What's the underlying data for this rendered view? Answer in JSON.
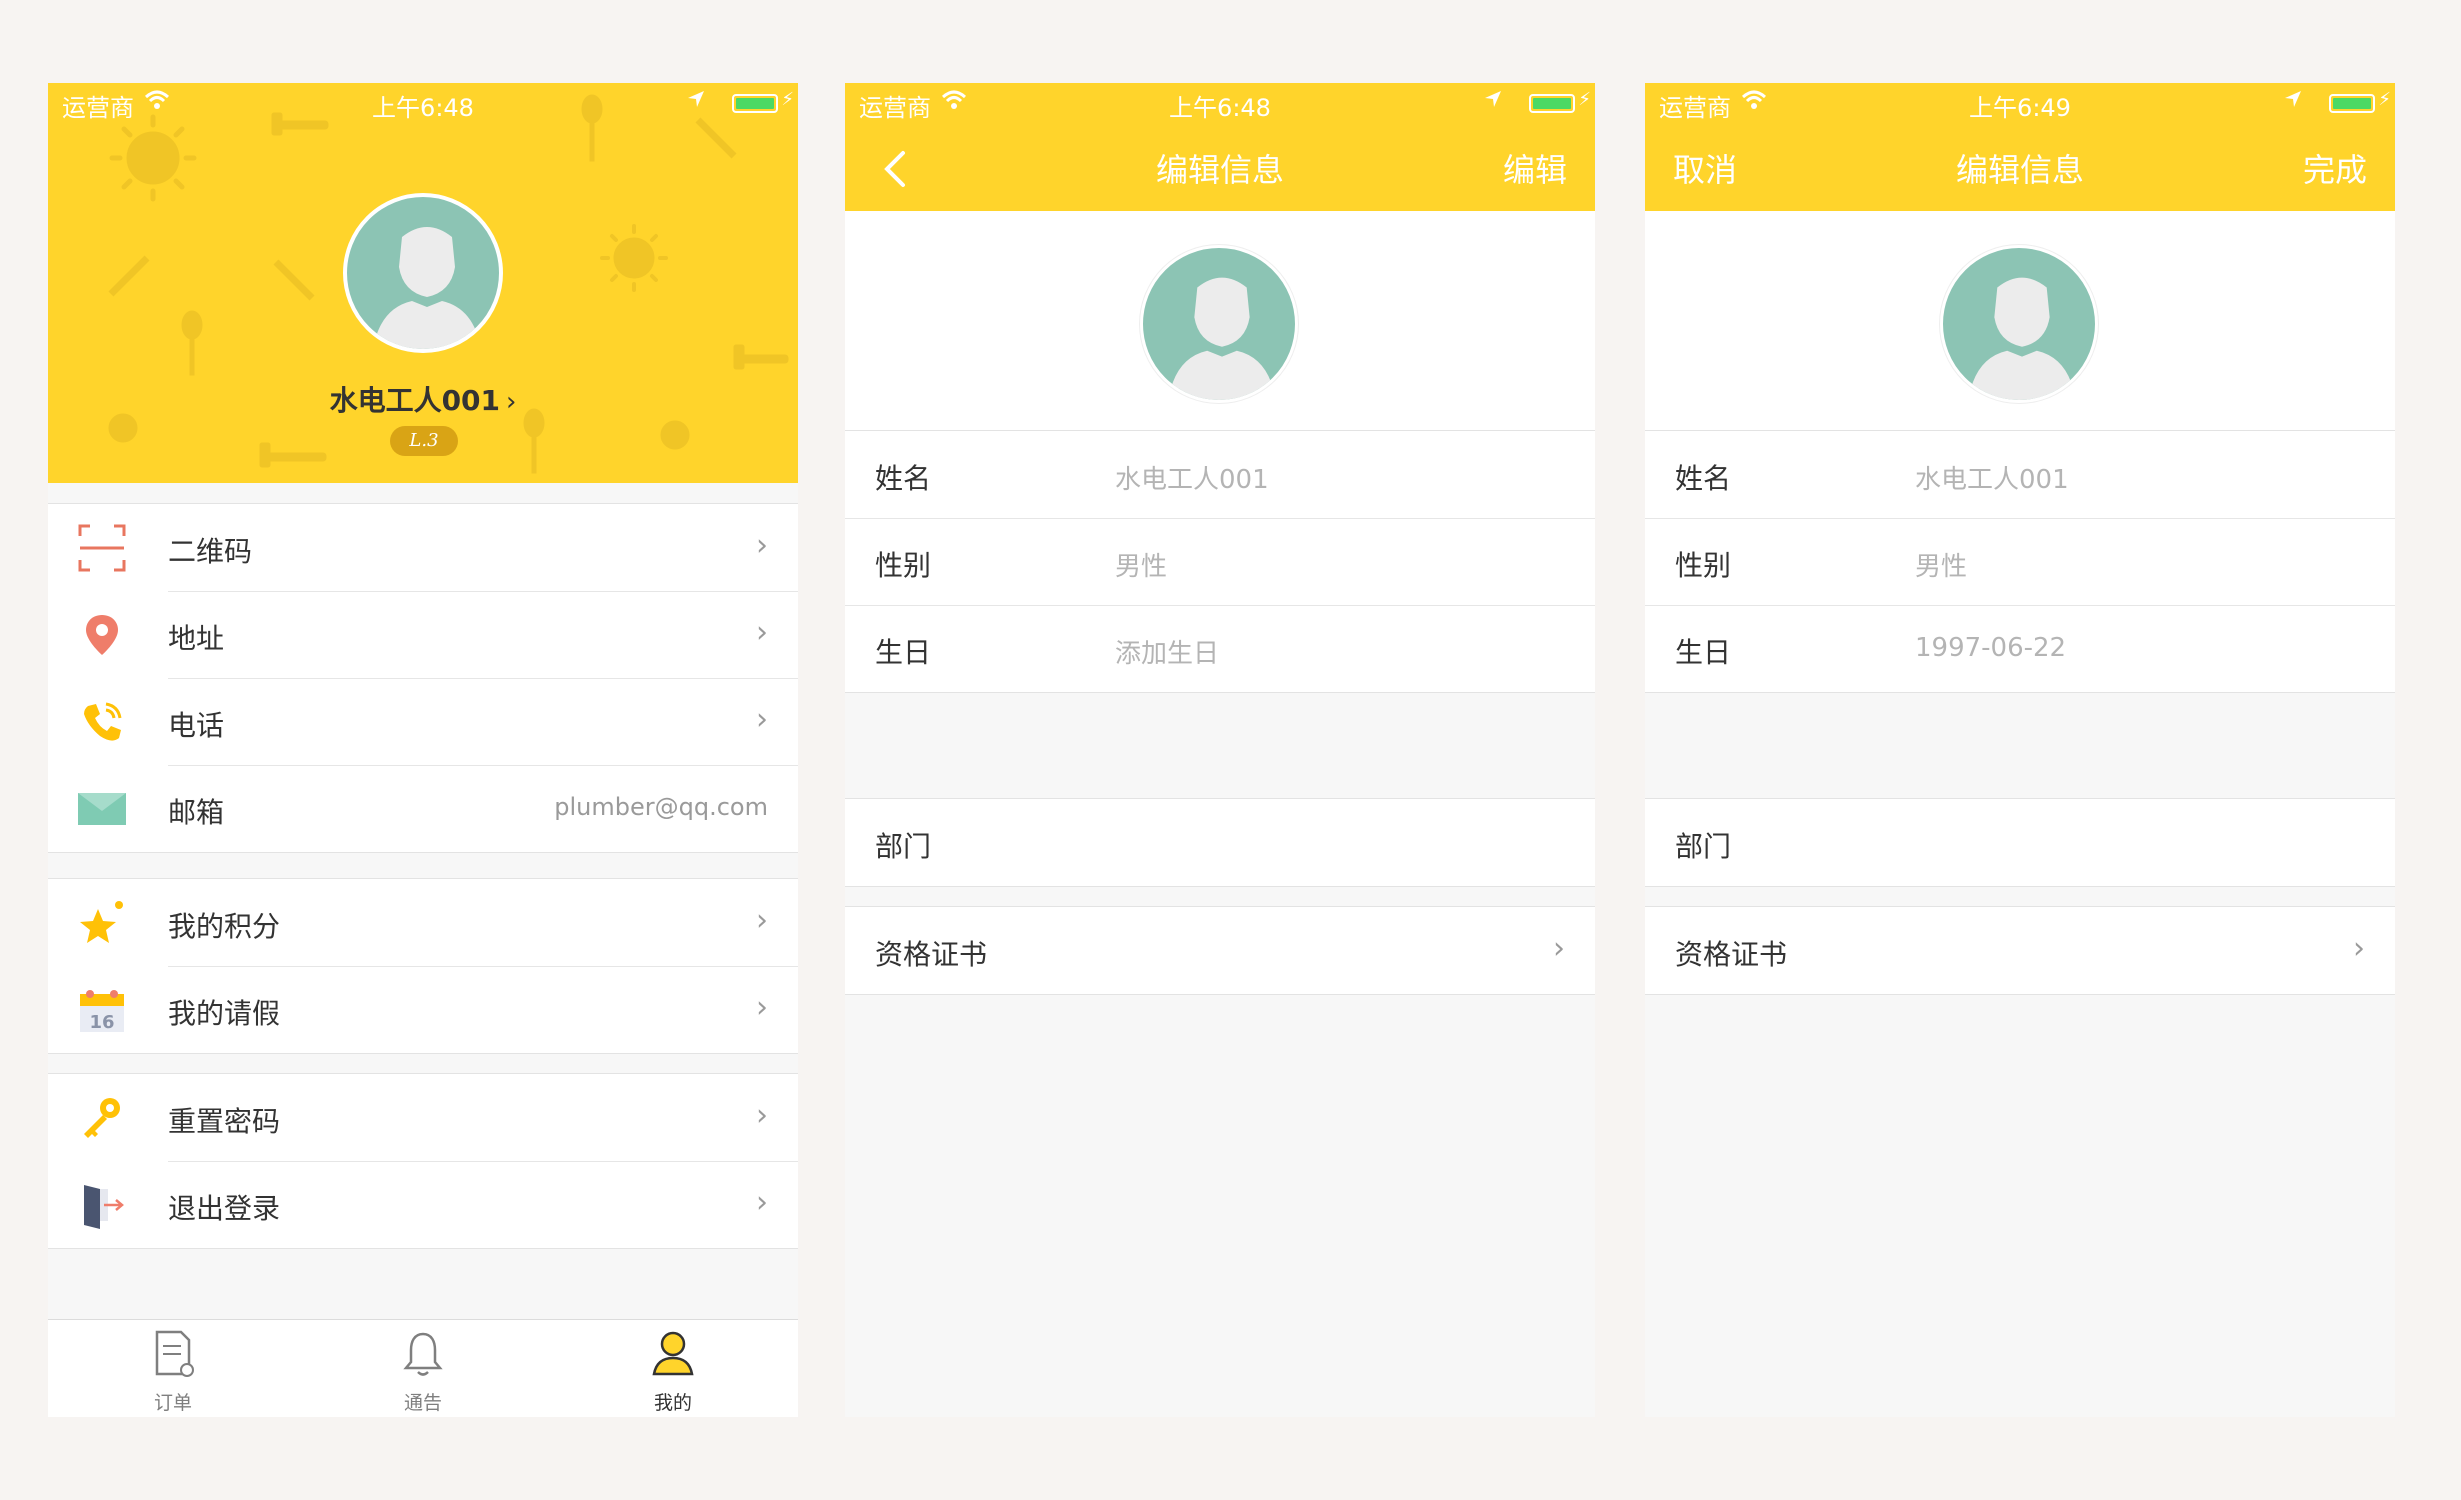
{
  "status_bar": {
    "screen1": {
      "carrier": "运营商",
      "time": "上午6:48"
    },
    "screen2": {
      "carrier": "运营商",
      "time": "上午6:48"
    },
    "screen3": {
      "carrier": "运营商",
      "time": "上午6:49"
    }
  },
  "profile": {
    "name": "水电工人001",
    "level": "L.3"
  },
  "menu_groups": {
    "group1": [
      {
        "label": "二维码",
        "icon": "qr-scan-icon"
      },
      {
        "label": "地址",
        "icon": "location-pin-icon"
      },
      {
        "label": "电话",
        "icon": "phone-icon"
      },
      {
        "label": "邮箱",
        "icon": "mail-icon",
        "value": "plumber@qq.com"
      }
    ],
    "group2": [
      {
        "label": "我的积分",
        "icon": "star-icon"
      },
      {
        "label": "我的请假",
        "icon": "calendar-icon",
        "icon_text": "16"
      }
    ],
    "group3": [
      {
        "label": "重置密码",
        "icon": "key-icon"
      },
      {
        "label": "退出登录",
        "icon": "logout-door-icon"
      }
    ]
  },
  "tabbar": {
    "tabs": [
      {
        "label": "订单",
        "icon": "order-doc-icon"
      },
      {
        "label": "通告",
        "icon": "bell-icon"
      },
      {
        "label": "我的",
        "icon": "user-icon",
        "active": true
      }
    ]
  },
  "edit_view": {
    "title": "编辑信息",
    "edit_button": "编辑",
    "fields": [
      {
        "label": "姓名",
        "value": "水电工人001"
      },
      {
        "label": "性别",
        "value": "男性"
      },
      {
        "label": "生日",
        "value": "添加生日"
      }
    ],
    "department_label": "部门",
    "certificate_label": "资格证书"
  },
  "edit_mode": {
    "title": "编辑信息",
    "cancel_button": "取消",
    "done_button": "完成",
    "fields": [
      {
        "label": "姓名",
        "value": "水电工人001"
      },
      {
        "label": "性别",
        "value": "男性"
      },
      {
        "label": "生日",
        "value": "1997-06-22"
      }
    ],
    "department_label": "部门",
    "certificate_label": "资格证书"
  },
  "colors": {
    "brand_yellow": "#ffd42b",
    "badge_gold": "#d9a415",
    "avatar_teal": "#8cc4b4",
    "battery_green": "#4cd964"
  }
}
